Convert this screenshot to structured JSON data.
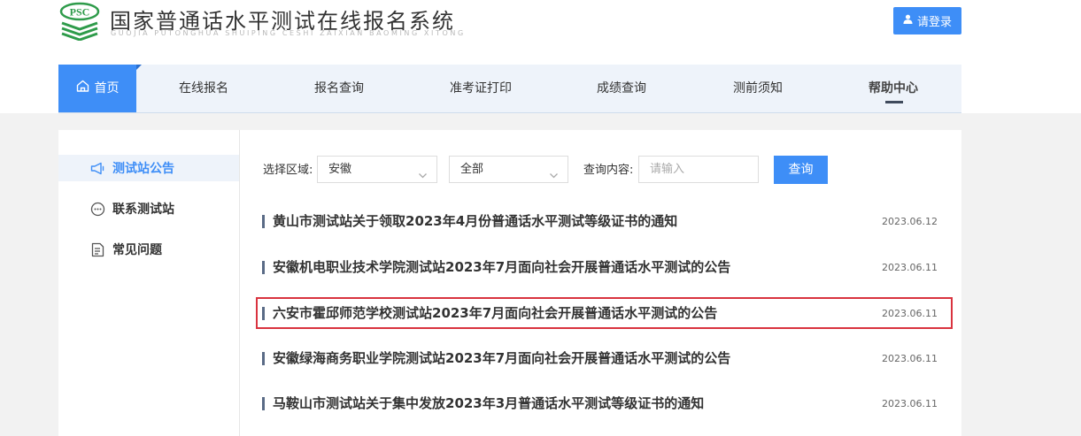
{
  "header": {
    "logo_text": "PSC",
    "title": "国家普通话水平测试在线报名系统",
    "subtitle": "GUOJIA PUTONGHUA SHUIPING CESHI ZAIXIAN BAOMING XITONG",
    "login_label": "请登录"
  },
  "nav": {
    "items": [
      {
        "label": "首页"
      },
      {
        "label": "在线报名"
      },
      {
        "label": "报名查询"
      },
      {
        "label": "准考证打印"
      },
      {
        "label": "成绩查询"
      },
      {
        "label": "测前须知"
      },
      {
        "label": "帮助中心"
      }
    ]
  },
  "sidebar": {
    "items": [
      {
        "label": "测试站公告",
        "icon": "megaphone-icon"
      },
      {
        "label": "联系测试站",
        "icon": "chat-icon"
      },
      {
        "label": "常见问题",
        "icon": "document-icon"
      }
    ]
  },
  "filter": {
    "region_label": "选择区域:",
    "province_value": "安徽",
    "city_value": "全部",
    "query_label": "查询内容:",
    "query_placeholder": "请输入",
    "query_button": "查询"
  },
  "news": [
    {
      "title": "黄山市测试站关于领取2023年4月份普通话水平测试等级证书的通知",
      "date": "2023.06.12"
    },
    {
      "title": "安徽机电职业技术学院测试站2023年7月面向社会开展普通话水平测试的公告",
      "date": "2023.06.11"
    },
    {
      "title": "六安市霍邱师范学校测试站2023年7月面向社会开展普通话水平测试的公告",
      "date": "2023.06.11"
    },
    {
      "title": "安徽绿海商务职业学院测试站2023年7月面向社会开展普通话水平测试的公告",
      "date": "2023.06.11"
    },
    {
      "title": "马鞍山市测试站关于集中发放2023年3月普通话水平测试等级证书的通知",
      "date": "2023.06.11"
    }
  ],
  "colors": {
    "accent": "#3e8ef7",
    "logo_green": "#2e9b4a",
    "highlight_border": "#d9333f"
  }
}
